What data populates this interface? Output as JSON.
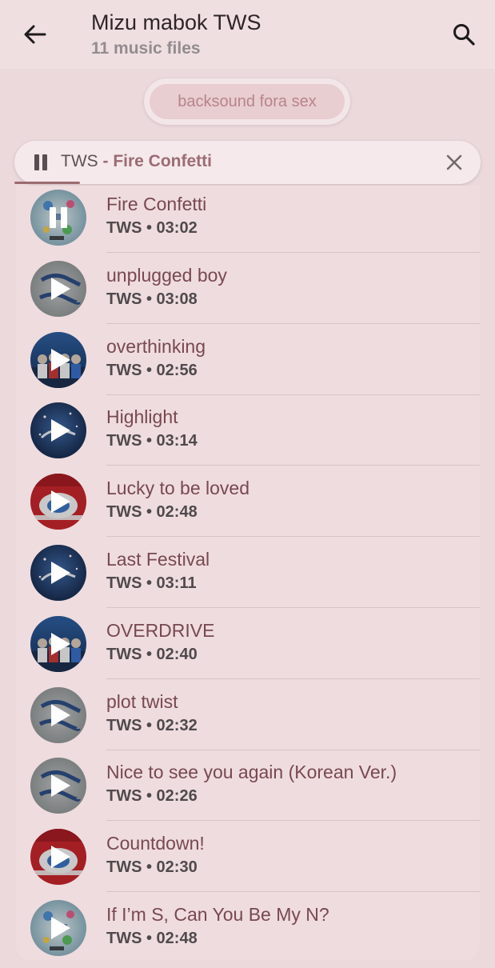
{
  "header": {
    "title": "Mizu mabok TWS",
    "subtitle": "11 music files"
  },
  "filter_chip": {
    "label": "backsound fora sex"
  },
  "mini_player": {
    "artist": "TWS",
    "separator": " - ",
    "track": "Fire Confetti",
    "progress": 0.14
  },
  "tracks": [
    {
      "title": "Fire Confetti",
      "meta": "TWS • 03:02",
      "state": "paused",
      "art": "sparkle"
    },
    {
      "title": "unplugged boy",
      "meta": "TWS • 03:08",
      "state": "play",
      "art": "grey"
    },
    {
      "title": "overthinking",
      "meta": "TWS • 02:56",
      "state": "play",
      "art": "group"
    },
    {
      "title": "Highlight",
      "meta": "TWS • 03:14",
      "state": "play",
      "art": "navy"
    },
    {
      "title": "Lucky to be loved",
      "meta": "TWS • 02:48",
      "state": "play",
      "art": "red"
    },
    {
      "title": "Last Festival",
      "meta": "TWS • 03:11",
      "state": "play",
      "art": "navy"
    },
    {
      "title": "OVERDRIVE",
      "meta": "TWS • 02:40",
      "state": "play",
      "art": "group"
    },
    {
      "title": "plot twist",
      "meta": "TWS • 02:32",
      "state": "play",
      "art": "grey"
    },
    {
      "title": "Nice to see you again (Korean Ver.)",
      "meta": "TWS • 02:26",
      "state": "play",
      "art": "grey"
    },
    {
      "title": "Countdown!",
      "meta": "TWS • 02:30",
      "state": "play",
      "art": "red"
    },
    {
      "title": "If I’m S, Can You Be My N?",
      "meta": "TWS • 02:48",
      "state": "play",
      "art": "sparkle"
    }
  ],
  "colors": {
    "background": "#ecd9dc",
    "accent": "#9b6c72",
    "title_text": "#77494f"
  }
}
